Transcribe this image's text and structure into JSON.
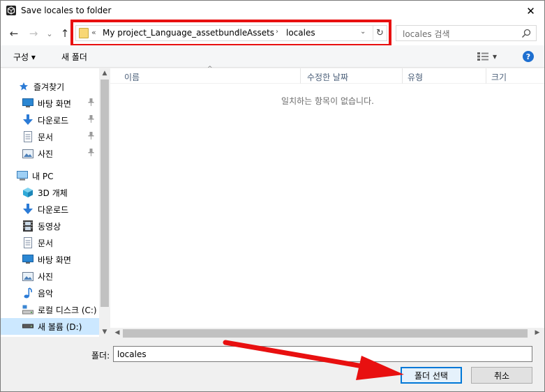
{
  "window": {
    "title": "Save locales to folder",
    "close_glyph": "✕"
  },
  "nav": {
    "back_glyph": "←",
    "forward_glyph": "→",
    "recent_glyph": "⌄",
    "up_glyph": "↑",
    "address": {
      "overflow": "«",
      "crumbs": [
        "My project_Language_assetbundle",
        "Assets",
        "locales"
      ],
      "separator": "›",
      "dropdown_glyph": "⌄",
      "refresh_glyph": "↻"
    },
    "search_placeholder": "locales 검색"
  },
  "commands": {
    "organize": "구성 ▾",
    "new_folder": "새 폴더",
    "view_caret": "▾",
    "help": "?"
  },
  "sidebar": {
    "items": [
      {
        "label": "즐겨찾기",
        "icon": "star-icon",
        "glyph": "★",
        "color": "#2b7bd6"
      },
      {
        "label": "바탕 화면",
        "icon": "desktop-icon",
        "pinned": true
      },
      {
        "label": "다운로드",
        "icon": "download-icon",
        "pinned": true
      },
      {
        "label": "문서",
        "icon": "documents-icon",
        "pinned": true
      },
      {
        "label": "사진",
        "icon": "pictures-icon",
        "pinned": true
      },
      {
        "label": "내 PC",
        "icon": "this-pc-icon"
      },
      {
        "label": "3D 개체",
        "icon": "3d-objects-icon"
      },
      {
        "label": "다운로드",
        "icon": "download-icon"
      },
      {
        "label": "동영상",
        "icon": "videos-icon"
      },
      {
        "label": "문서",
        "icon": "documents-icon"
      },
      {
        "label": "바탕 화면",
        "icon": "desktop-icon"
      },
      {
        "label": "사진",
        "icon": "pictures-icon"
      },
      {
        "label": "음악",
        "icon": "music-icon"
      },
      {
        "label": "로컬 디스크 (C:)",
        "icon": "local-disk-icon"
      },
      {
        "label": "새 볼륨 (D:)",
        "icon": "volume-icon",
        "selected": true
      }
    ],
    "pin_glyph": "📌"
  },
  "file_list": {
    "columns": [
      "이름",
      "수정한 날짜",
      "유형",
      "크기"
    ],
    "sort_glyph": "^",
    "empty_message": "일치하는 항목이 없습니다."
  },
  "bottom": {
    "folder_label": "폴더:",
    "folder_value": "locales",
    "select_button": "폴더 선택",
    "cancel_button": "취소"
  },
  "annotations": {
    "highlight_color": "#e81010"
  }
}
